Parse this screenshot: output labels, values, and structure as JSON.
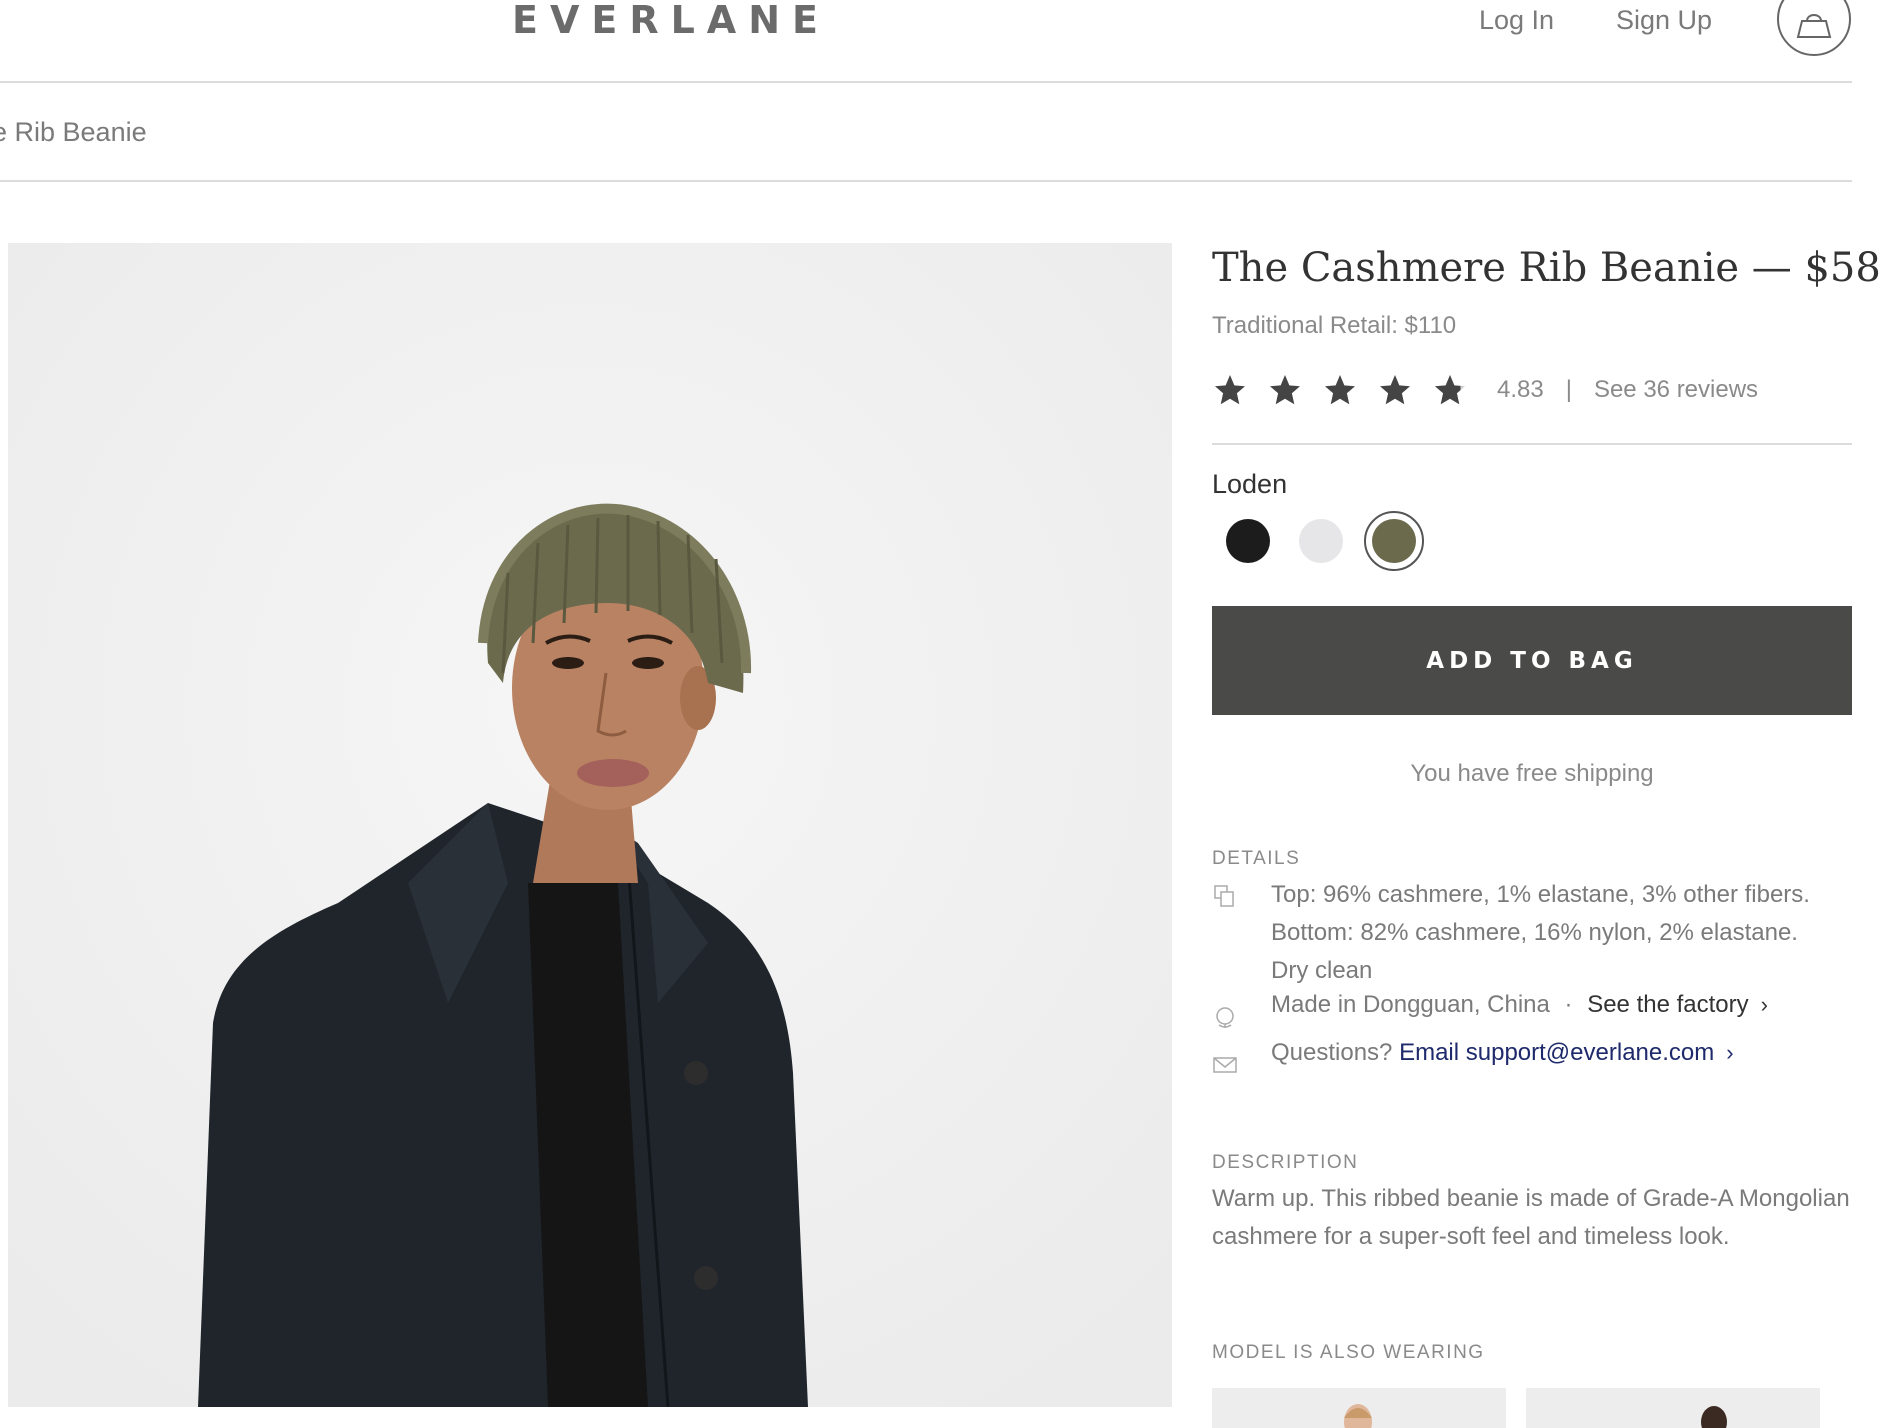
{
  "header": {
    "logo": "EVERLANE",
    "login_label": "Log In",
    "signup_label": "Sign Up"
  },
  "breadcrumb": {
    "current": "e Rib Beanie"
  },
  "product": {
    "title": "The Cashmere Rib Beanie — $58",
    "traditional_retail": "Traditional Retail: $110",
    "rating": "4.83",
    "rating_value": 4.83,
    "rating_max": 5,
    "rating_separator": "|",
    "reviews_link": "See 36 reviews",
    "selected_color": "Loden",
    "swatches": [
      {
        "name": "black",
        "color": "#1c1c1c"
      },
      {
        "name": "light-grey",
        "color": "#e6e6e8"
      },
      {
        "name": "loden",
        "color": "#6b6a4d"
      }
    ],
    "add_to_bag": "ADD TO BAG",
    "shipping_note": "You have free shipping"
  },
  "details": {
    "label": "DETAILS",
    "materials_line1": "Top: 96% cashmere, 1% elastane, 3% other fibers.",
    "materials_line2": "Bottom: 82% cashmere, 16% nylon, 2% elastane.",
    "care": "Dry clean",
    "origin": "Made in Dongguan, China",
    "origin_sep": "·",
    "factory_link": "See the factory",
    "questions": "Questions?",
    "email_link": "Email support@everlane.com"
  },
  "description": {
    "label": "DESCRIPTION",
    "text": "Warm up. This ribbed beanie is made of Grade-A Mongolian cashmere for a super-soft feel and timeless look."
  },
  "model_wearing": {
    "label": "MODEL IS ALSO WEARING"
  },
  "colors": {
    "button": "#4a4a48",
    "text_muted": "#8a8a8a",
    "link_blue": "#1e2a6b"
  }
}
